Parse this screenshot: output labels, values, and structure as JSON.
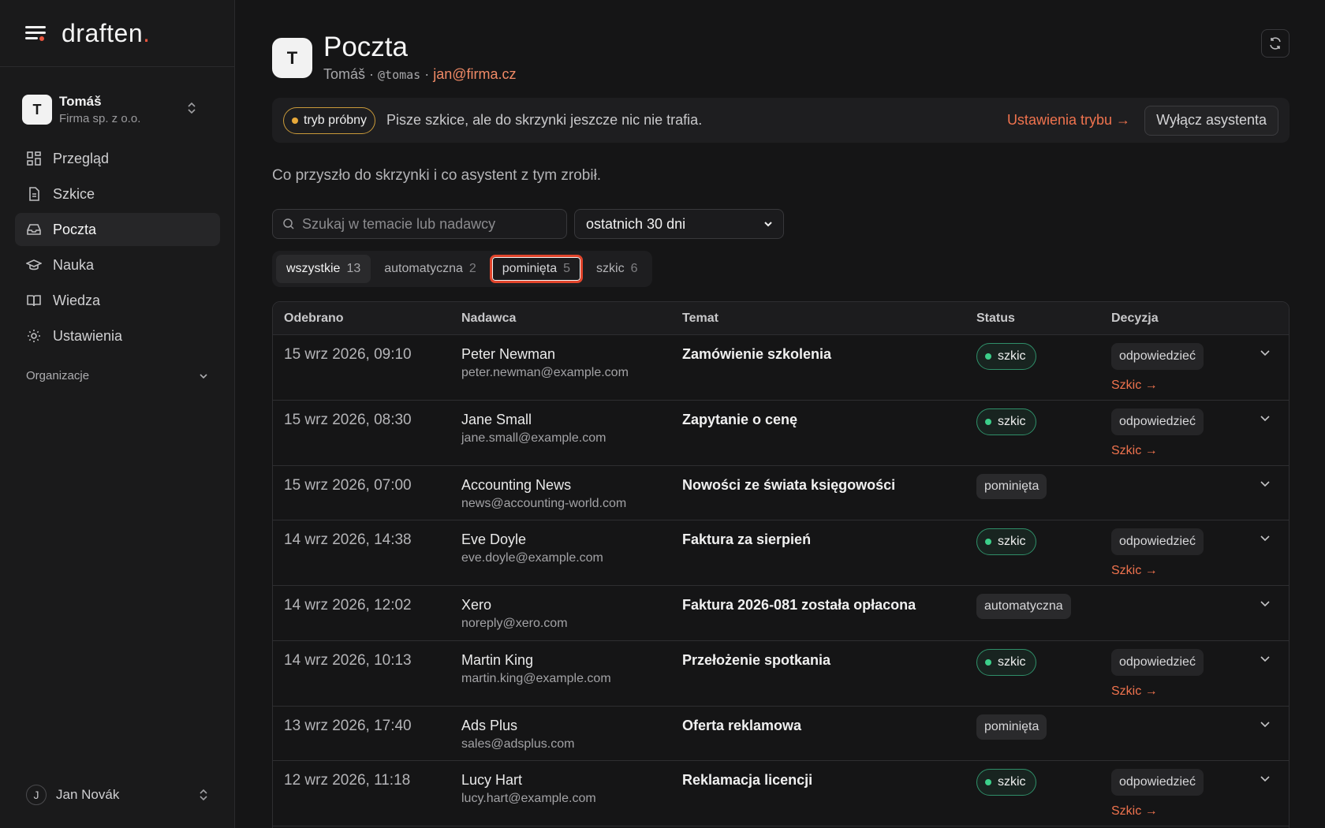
{
  "brand": {
    "name": "draften",
    "dot": "."
  },
  "org": {
    "avatar": "T",
    "name": "Tomáš",
    "company": "Firma sp. z o.o."
  },
  "nav": {
    "items": [
      {
        "label": "Przegląd",
        "icon": "dashboard-icon"
      },
      {
        "label": "Szkice",
        "icon": "document-icon"
      },
      {
        "label": "Poczta",
        "icon": "inbox-icon"
      },
      {
        "label": "Nauka",
        "icon": "graduation-cap-icon"
      },
      {
        "label": "Wiedza",
        "icon": "book-icon"
      },
      {
        "label": "Ustawienia",
        "icon": "gear-icon"
      }
    ],
    "section": "Organizacje"
  },
  "user": {
    "avatar": "J",
    "name": "Jan Novák"
  },
  "header": {
    "avatar": "T",
    "title": "Poczta",
    "name": "Tomáš",
    "sep1": " · ",
    "handle": "@tomas",
    "sep2": " · ",
    "email": "jan@firma.cz"
  },
  "banner": {
    "pill": "tryb próbny",
    "text": "Pisze szkice, ale do skrzynki jeszcze nic nie trafia.",
    "link": "Ustawienia trybu →",
    "button": "Wyłącz asystenta"
  },
  "intro": "Co przyszło do skrzynki i co asystent z tym zrobił.",
  "filters": {
    "search_placeholder": "Szukaj w temacie lub nadawcy",
    "period": "ostatnich 30 dni"
  },
  "tabs": [
    {
      "label": "wszystkie",
      "count": "13"
    },
    {
      "label": "automatyczna",
      "count": "2"
    },
    {
      "label": "pominięta",
      "count": "5"
    },
    {
      "label": "szkic",
      "count": "6"
    }
  ],
  "table": {
    "headers": [
      "Odebrano",
      "Nadawca",
      "Temat",
      "Status",
      "Decyzja"
    ],
    "rows": [
      {
        "date": "15 wrz 2026, 09:10",
        "name": "Peter Newman",
        "email": "peter.newman@example.com",
        "subject": "Zamówienie szkolenia",
        "status": "szkic",
        "decision": "odpowiedzieć",
        "draft": "Szkic →"
      },
      {
        "date": "15 wrz 2026, 08:30",
        "name": "Jane Small",
        "email": "jane.small@example.com",
        "subject": "Zapytanie o cenę",
        "status": "szkic",
        "decision": "odpowiedzieć",
        "draft": "Szkic →"
      },
      {
        "date": "15 wrz 2026, 07:00",
        "name": "Accounting News",
        "email": "news@accounting-world.com",
        "subject": "Nowości ze świata księgowości",
        "status": "pominięta"
      },
      {
        "date": "14 wrz 2026, 14:38",
        "name": "Eve Doyle",
        "email": "eve.doyle@example.com",
        "subject": "Faktura za sierpień",
        "status": "szkic",
        "decision": "odpowiedzieć",
        "draft": "Szkic →"
      },
      {
        "date": "14 wrz 2026, 12:02",
        "name": "Xero",
        "email": "noreply@xero.com",
        "subject": "Faktura 2026-081 została opłacona",
        "status": "automatyczna"
      },
      {
        "date": "14 wrz 2026, 10:13",
        "name": "Martin King",
        "email": "martin.king@example.com",
        "subject": "Przełożenie spotkania",
        "status": "szkic",
        "decision": "odpowiedzieć",
        "draft": "Szkic →"
      },
      {
        "date": "13 wrz 2026, 17:40",
        "name": "Ads Plus",
        "email": "sales@adsplus.com",
        "subject": "Oferta reklamowa",
        "status": "pominięta"
      },
      {
        "date": "12 wrz 2026, 11:18",
        "name": "Lucy Hart",
        "email": "lucy.hart@example.com",
        "subject": "Reklamacja licencji",
        "status": "szkic",
        "decision": "odpowiedzieć",
        "draft": "Szkic →"
      }
    ]
  },
  "colors": {
    "accent": "#f0734e",
    "brand_dot": "#e8553e",
    "draft_green": "#3ccf8a",
    "trial_amber": "#e8a93a"
  }
}
